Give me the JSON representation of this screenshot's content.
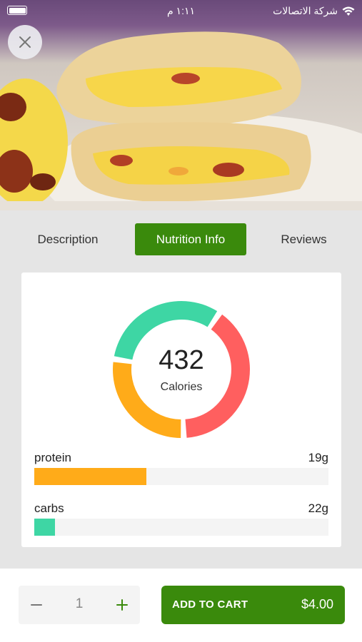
{
  "status_bar": {
    "time": "١:١١ م",
    "carrier": "شركة الاتصالات"
  },
  "product": {
    "image_alt": "Breakfast pastry with egg, cheese and bacon"
  },
  "tabs": [
    {
      "label": "Description",
      "active": false
    },
    {
      "label": "Nutrition Info",
      "active": true
    },
    {
      "label": "Reviews",
      "active": false
    }
  ],
  "nutrition": {
    "calories_value": "432",
    "calories_label": "Calories",
    "donut_segments": [
      {
        "color": "#ff5f5f",
        "fraction": 0.4
      },
      {
        "color": "#ffab19",
        "fraction": 0.28
      },
      {
        "color": "#3ed6a4",
        "fraction": 0.32
      }
    ],
    "nutrients": [
      {
        "name": "protein",
        "amount": "19g",
        "fraction": 0.38,
        "color": "#ffab19"
      },
      {
        "name": "carbs",
        "amount": "22g",
        "fraction": 0.07,
        "color": "#3ed6a4"
      }
    ]
  },
  "cart": {
    "quantity": "1",
    "add_label": "ADD TO CART",
    "price": "$4.00"
  },
  "colors": {
    "accent": "#3a8a0c",
    "background": "#e5e5e5"
  }
}
